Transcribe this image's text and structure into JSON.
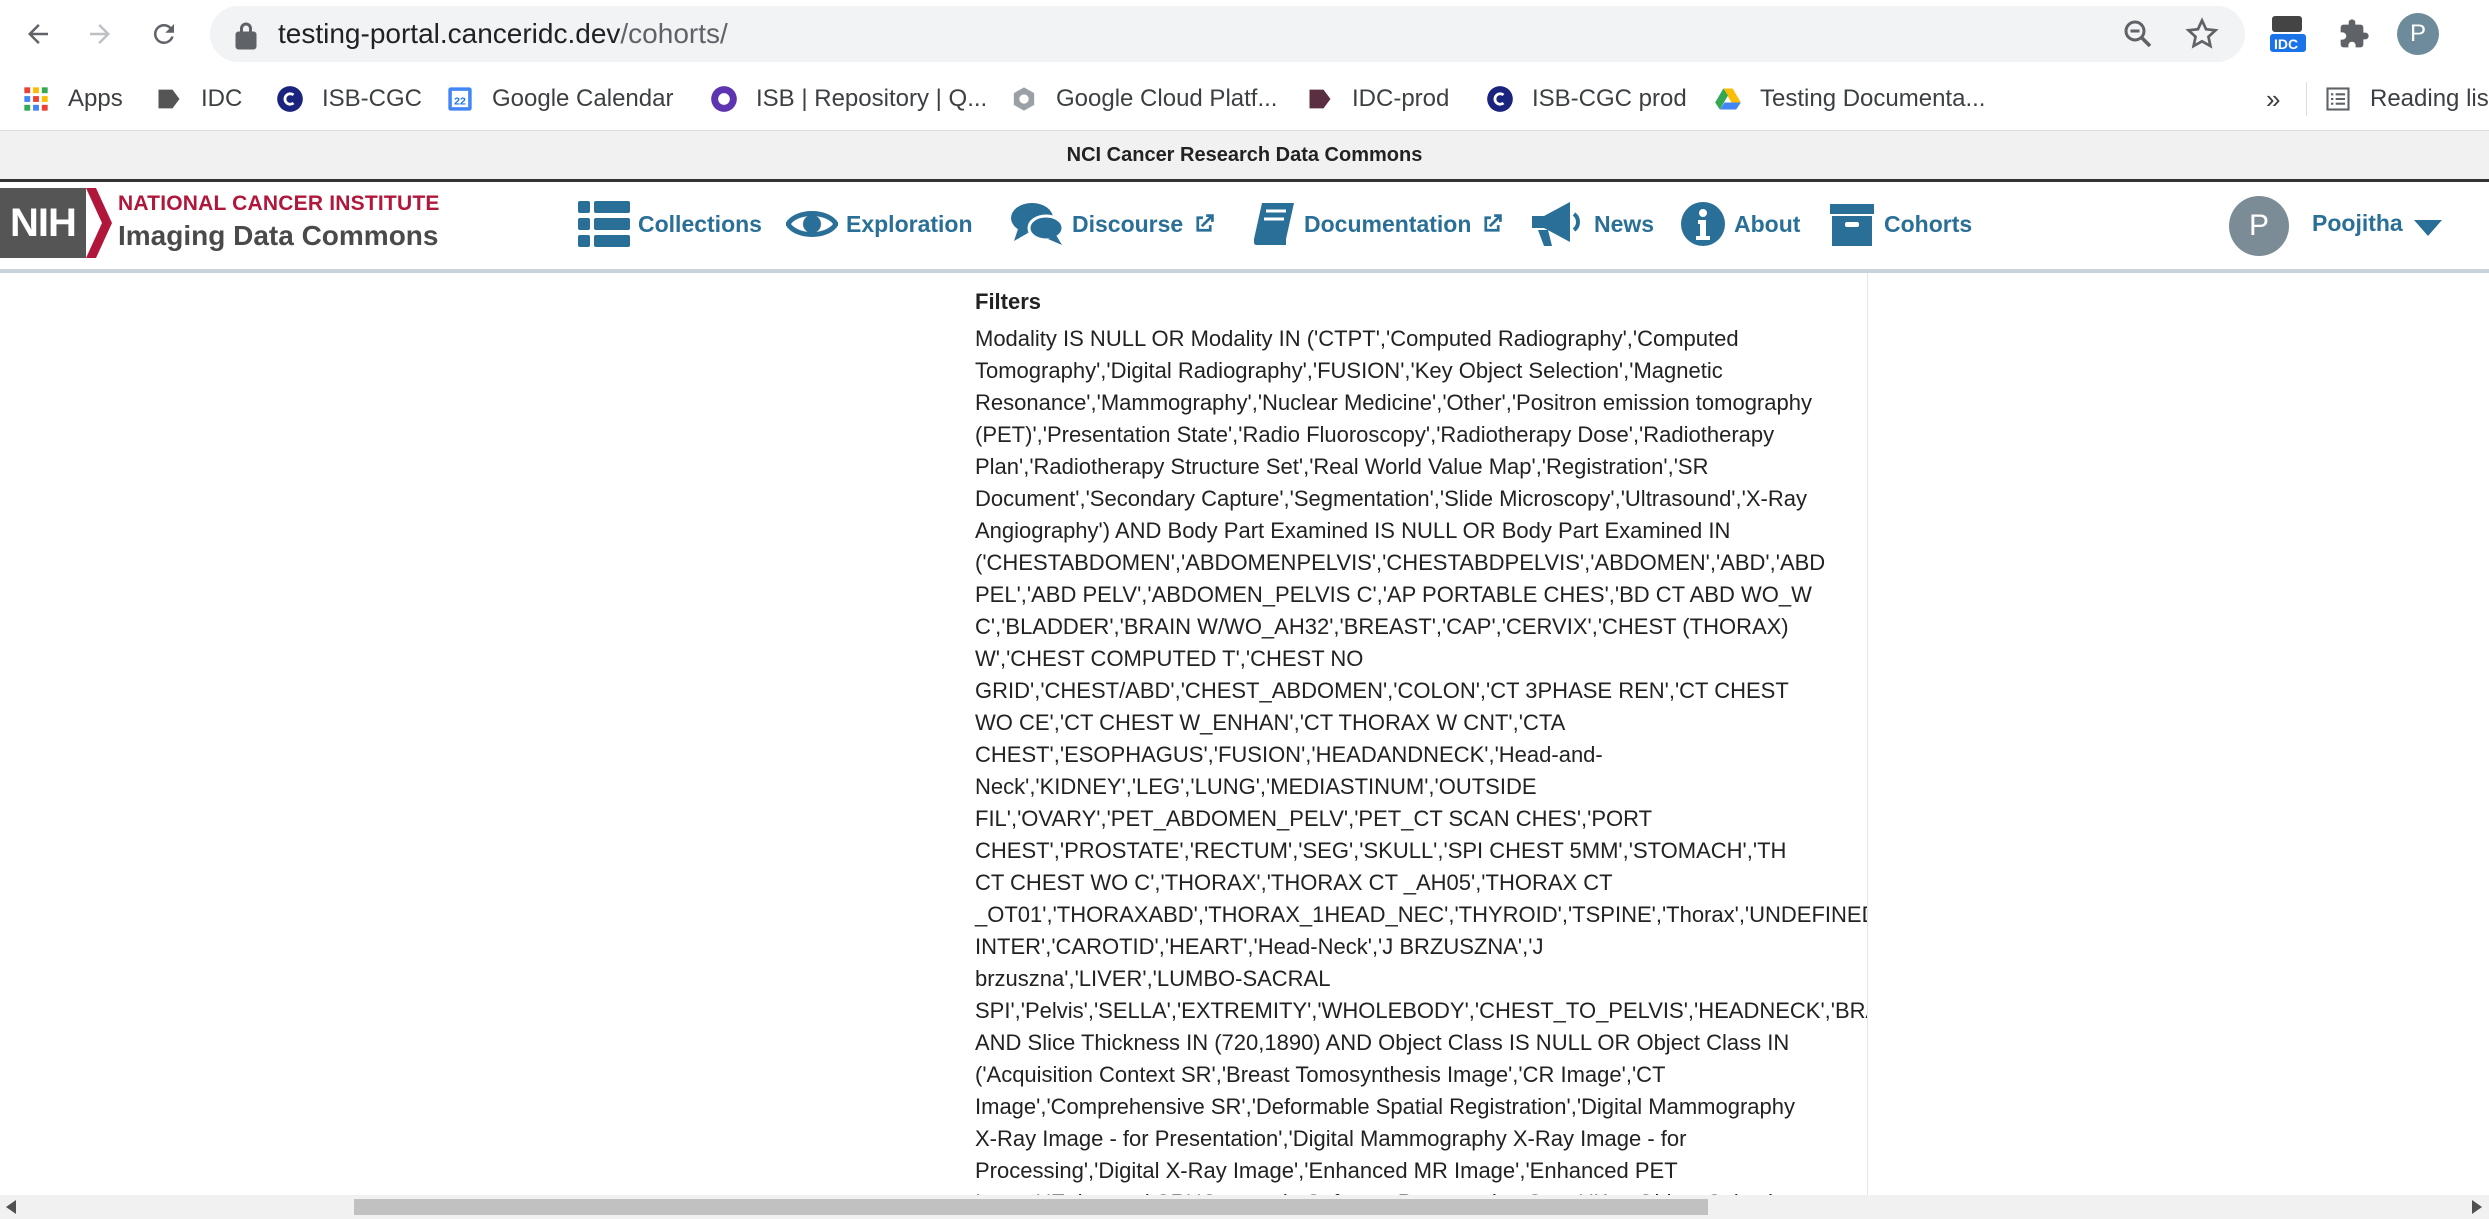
{
  "browser": {
    "url_host": "testing-portal.canceridc.dev",
    "url_path": "/cohorts/",
    "profile_initial": "P",
    "extension_label": "IDC"
  },
  "bookmarks": {
    "items": [
      {
        "label": "Apps",
        "icon": "apps-grid-icon"
      },
      {
        "label": "IDC",
        "icon": "idc-bookmark-icon"
      },
      {
        "label": "ISB-CGC",
        "icon": "isb-cgc-icon"
      },
      {
        "label": "Google Calendar",
        "icon": "calendar-icon"
      },
      {
        "label": "ISB | Repository | Q...",
        "icon": "isb-repository-icon"
      },
      {
        "label": "Google Cloud Platf...",
        "icon": "cloud-platform-icon"
      },
      {
        "label": "IDC-prod",
        "icon": "idc-prod-icon"
      },
      {
        "label": "ISB-CGC prod",
        "icon": "isb-cgc-prod-icon"
      },
      {
        "label": "Testing Documenta...",
        "icon": "drive-icon"
      }
    ],
    "overflow": "»",
    "reading_list": "Reading lis"
  },
  "banner": {
    "text": "NCI Cancer Research Data Commons"
  },
  "header": {
    "logo_abbr": "NIH",
    "logo_line1": "NATIONAL CANCER INSTITUTE",
    "logo_line2": "Imaging Data Commons",
    "nav": {
      "collections": "Collections",
      "exploration": "Exploration",
      "discourse": "Discourse",
      "documentation": "Documentation",
      "news": "News",
      "about": "About",
      "cohorts": "Cohorts"
    },
    "user_initial": "P",
    "user_name": "Poojitha"
  },
  "colors": {
    "nav_link": "#2a6f97",
    "nci_red": "#b1173b"
  },
  "filters": {
    "label": "Filters",
    "lines": [
      "Modality IS NULL OR Modality IN ('CTPT','Computed Radiography','Computed",
      "Tomography','Digital Radiography','FUSION','Key Object Selection','Magnetic",
      "Resonance','Mammography','Nuclear Medicine','Other','Positron emission tomography",
      "(PET)','Presentation State','Radio Fluoroscopy','Radiotherapy Dose','Radiotherapy",
      "Plan','Radiotherapy Structure Set','Real World Value Map','Registration','SR",
      "Document','Secondary Capture','Segmentation','Slide Microscopy','Ultrasound','X-Ray",
      "Angiography') AND Body Part Examined IS NULL OR Body Part Examined IN",
      "('CHESTABDOMEN','ABDOMENPELVIS','CHESTABDPELVIS','ABDOMEN','ABD','ABD",
      "PEL','ABD PELV','ABDOMEN_PELVIS C','AP PORTABLE CHES','BD CT ABD WO_W",
      "C','BLADDER','BRAIN W/WO_AH32','BREAST','CAP','CERVIX','CHEST (THORAX)",
      "W','CHEST COMPUTED T','CHEST NO",
      "GRID','CHEST/ABD','CHEST_ABDOMEN','COLON','CT 3PHASE REN','CT CHEST",
      "WO CE','CT CHEST W_ENHAN','CT THORAX W CNT','CTA",
      "CHEST','ESOPHAGUS','FUSION','HEADANDNECK','Head-and-",
      "Neck','KIDNEY','LEG','LUNG','MEDIASTINUM','OUTSIDE",
      "FIL','OVARY','PET_ABDOMEN_PELV','PET_CT SCAN CHES','PORT",
      "CHEST','PROSTATE','RECTUM','SEG','SKULL','SPI CHEST 5MM','STOMACH','TH",
      "CT CHEST WO C','THORAX','THORAX CT _AH05','THORAX CT",
      "_OT01','THORAXABD','THORAX_1HEAD_NEC','THYROID','TSPINE','Thorax','UNDEFINED','UTERUS','WO",
      "INTER','CAROTID','HEART','Head-Neck','J BRZUSZNA','J",
      "brzuszna','LIVER','LUMBO-SACRAL",
      "SPI','Pelvis','SELLA','EXTREMITY','WHOLEBODY','CHEST_TO_PELVIS','HEADNECK','BRAIN','NECK','PANCREAS','HEAD','PELVIS','CHEST')",
      "AND Slice Thickness IN (720,1890) AND Object Class IS NULL OR Object Class IN",
      "('Acquisition Context SR','Breast Tomosynthesis Image','CR Image','CT",
      "Image','Comprehensive SR','Deformable Spatial Registration','Digital Mammography",
      "X-Ray Image - for Presentation','Digital Mammography X-Ray Image - for",
      "Processing','Digital X-Ray Image','Enhanced MR Image','Enhanced PET",
      "Image','Enhanced SR','Grayscale Softcopy Presentation State','Key Object Selection"
    ]
  }
}
